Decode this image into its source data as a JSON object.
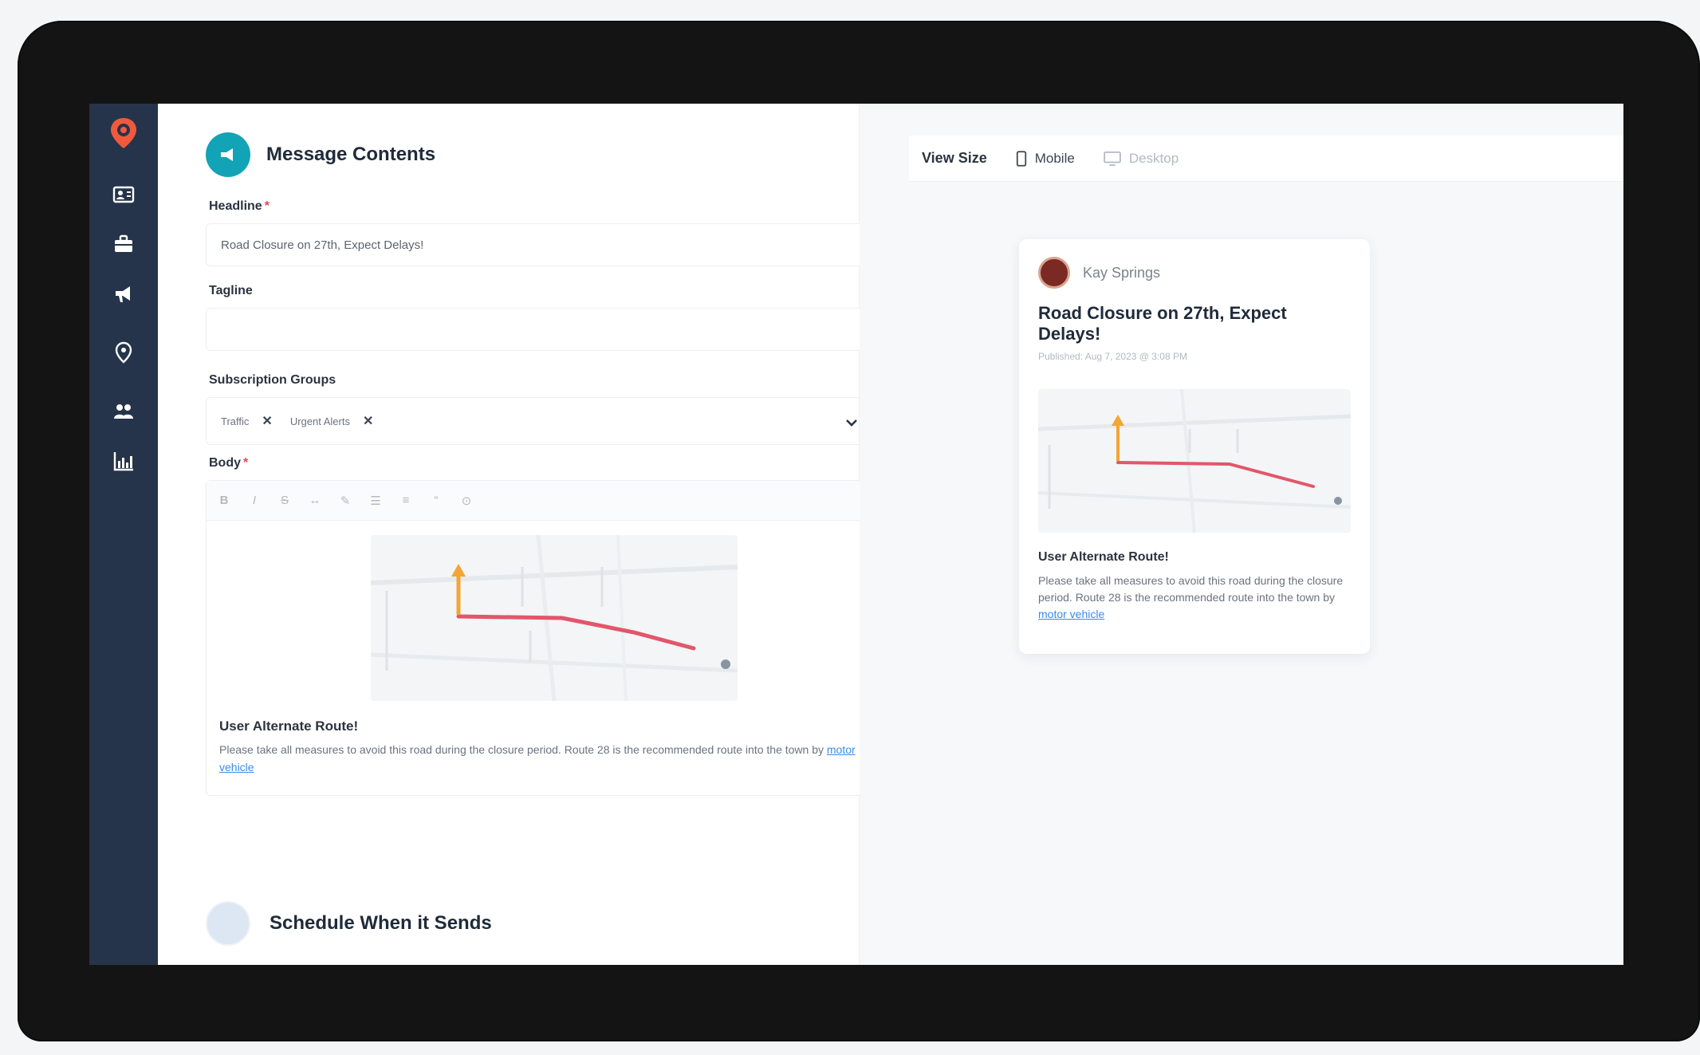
{
  "sidebar": {
    "logo": "location-pin-logo",
    "items": [
      {
        "icon": "contact-card-icon"
      },
      {
        "icon": "briefcase-icon"
      },
      {
        "icon": "megaphone-icon"
      },
      {
        "icon": "location-alert-icon"
      },
      {
        "icon": "users-icon"
      },
      {
        "icon": "analytics-icon"
      }
    ]
  },
  "form": {
    "section_title": "Message Contents",
    "headline_label": "Headline",
    "headline_value": "Road Closure on 27th, Expect Delays!",
    "tagline_label": "Tagline",
    "tagline_value": "",
    "groups_label": "Subscription Groups",
    "groups": [
      "Traffic",
      "Urgent Alerts"
    ],
    "body_label": "Body",
    "toolbar": [
      "B",
      "I",
      "S",
      "↔",
      "✎",
      "☰",
      "≡",
      "“",
      "⊙"
    ],
    "body_heading": "User Alternate Route!",
    "body_text": "Please take all measures to avoid this road during the closure period. Route 28 is the recommended route into the town by",
    "body_link": "motor vehicle",
    "schedule_title": "Schedule When it Sends"
  },
  "preview": {
    "view_size_label": "View Size",
    "mobile_label": "Mobile",
    "desktop_label": "Desktop",
    "author": "Kay Springs",
    "title": "Road Closure on 27th, Expect Delays!",
    "meta": "Published: Aug 7, 2023 @ 3:08 PM",
    "heading": "User Alternate Route!",
    "text": "Please take all measures to avoid this road during the closure period. Route 28 is the recommended route into the town by",
    "link": "motor vehicle"
  },
  "colors": {
    "sidebar": "#25344a",
    "accent": "#13a3b7",
    "logo": "#f05a3c",
    "route": "#e2566b",
    "marker": "#f3a536",
    "link": "#3b8be6"
  }
}
